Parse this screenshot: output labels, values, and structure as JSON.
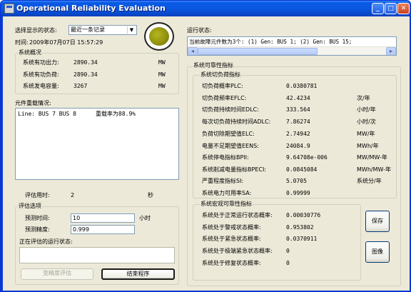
{
  "window": {
    "title": "Operational Reliability Evaluation"
  },
  "left": {
    "select_label": "选择显示的状态:",
    "select_value": "最近一条记录",
    "time_label": "时间:",
    "time_value": "2009年07月07日  15:57:29",
    "overview_title": "系统概况",
    "overview": [
      {
        "label": "系统有功出力:",
        "value": "2890.34",
        "unit": "MW"
      },
      {
        "label": "系统有功负荷:",
        "value": "2890.34",
        "unit": "MW"
      },
      {
        "label": "系统发电容量:",
        "value": "3267",
        "unit": "MW"
      }
    ],
    "element_title": "元件重载情况:",
    "element_line_left": "Line: BUS 7 BUS 8",
    "element_line_right": "重载率为88.9%",
    "eval_time_label": "评估用时:",
    "eval_time_value": "2",
    "eval_time_unit": "秒",
    "options_title": "评估选项",
    "predict_time_label": "预测时间:",
    "predict_time_value": "10",
    "predict_time_unit": "小时",
    "precision_label": "预测精度:",
    "precision_value": "0.999",
    "running_state_label": "正在评估的运行状态:",
    "btn_change": "变精度评估",
    "btn_exit": "结束程序"
  },
  "right": {
    "run_state_label": "运行状态:",
    "run_state_text": "当前故障元件数为3个: (1) Gen: BUS 1;      (2) Gen: BUS 15;",
    "reliability_title": "系统可靠性指标",
    "load_title": "系统切负荷指标",
    "load_indices": [
      {
        "label": "切负荷概率PLC:",
        "value": "0.0380781",
        "unit": ""
      },
      {
        "label": "切负荷频率EFLC:",
        "value": "42.4234",
        "unit": "次/年"
      },
      {
        "label": "切负荷持续时间EDLC:",
        "value": "333.564",
        "unit": "小时/年"
      },
      {
        "label": "每次切负荷持续时间ADLC:",
        "value": "7.86274",
        "unit": "小时/次"
      },
      {
        "label": "负荷切除期望值ELC:",
        "value": "2.74942",
        "unit": "MW/年"
      },
      {
        "label": "电量不足期望值EENS:",
        "value": "24084.9",
        "unit": "MWh/年"
      },
      {
        "label": "系统停电指标BPII:",
        "value": "9.64708e-006",
        "unit": "MW/MW-年"
      },
      {
        "label": "系统削减电量指标BPECI:",
        "value": "0.0845084",
        "unit": "MWh/MW-年"
      },
      {
        "label": "严重程度指标SI:",
        "value": "5.0705",
        "unit": "系统分/年"
      },
      {
        "label": "系统电力可用率SA:",
        "value": "0.99999",
        "unit": ""
      }
    ],
    "macro_title": "系统宏观可靠性指标",
    "macro_indices": [
      {
        "label": "系统处于正常运行状态概率:",
        "value": "0.00030776"
      },
      {
        "label": "系统处于警戒状态概率:",
        "value": "0.953802"
      },
      {
        "label": "系统处于紧急状态概率:",
        "value": "0.0370911"
      },
      {
        "label": "系统处于极端紧急状态概率:",
        "value": "0"
      },
      {
        "label": "系统处于修复状态概率:",
        "value": "0"
      }
    ],
    "btn_save": "保存",
    "btn_image": "图像"
  },
  "colors": {
    "indicator": "#8f8f0c",
    "titlebar": "#0a5ae6"
  }
}
